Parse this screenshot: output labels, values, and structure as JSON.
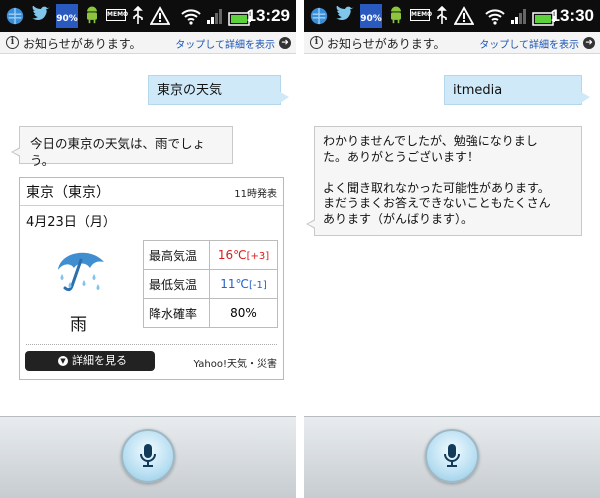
{
  "status_bar": {
    "time_left": "13:29",
    "time_right": "13:30",
    "battery_badge": "90%",
    "memo_label": "MEMO"
  },
  "notice": {
    "text": "お知らせがあります。",
    "link": "タップして詳細を表示",
    "info_glyph": "i",
    "arrow_glyph": "➜"
  },
  "left": {
    "user_query": "東京の天気",
    "reply": "今日の東京の天気は、雨でしょう。",
    "weather": {
      "city": "東京（東京）",
      "issued": "11時発表",
      "date": "4月23日（月）",
      "condition": "雨",
      "rows": [
        {
          "label": "最高気温",
          "value": "16℃",
          "delta": "[+3]"
        },
        {
          "label": "最低気温",
          "value": "11℃",
          "delta": "[-1]"
        },
        {
          "label": "降水確率",
          "value": "80%",
          "delta": ""
        }
      ],
      "detail_button": "詳細を見る",
      "source": "Yahoo!天気・災害"
    }
  },
  "right": {
    "user_query": "itmedia",
    "reply_lines": [
      "わかりませんでしたが、勉強になりまし",
      "た。ありがとうございます！",
      "",
      "よく聞き取れなかった可能性があります。",
      "まだうまくお答えできないこともたくさん",
      "あります（がんばります）。"
    ]
  },
  "icons": [
    "info-icon",
    "arrow-icon",
    "umbrella-icon",
    "microphone-icon",
    "wifi-icon",
    "battery-icon",
    "signal-icon",
    "usb-icon",
    "warning-icon",
    "twitter-bird-icon",
    "android-icon"
  ],
  "colors": {
    "high_temp": "#d81a1a",
    "low_temp": "#2463c8",
    "user_bubble": "#cfe9f8",
    "link": "#1a55b5"
  }
}
